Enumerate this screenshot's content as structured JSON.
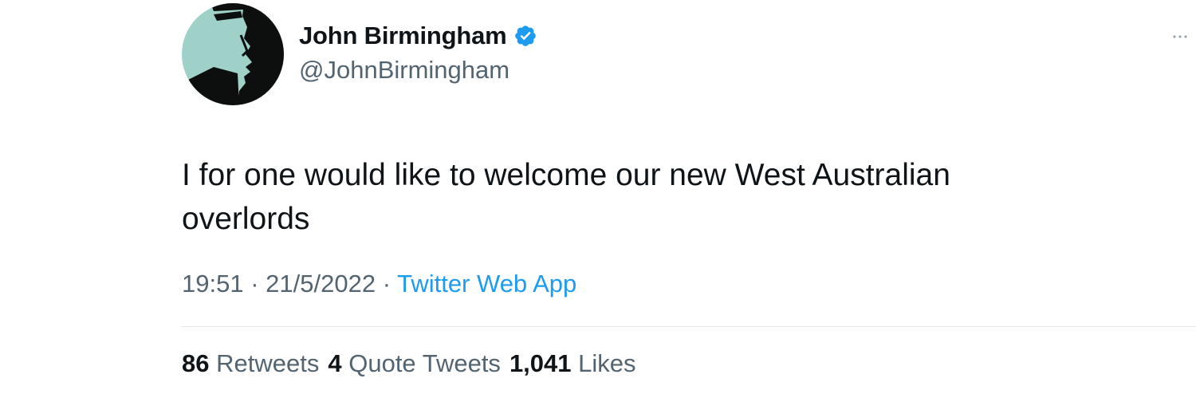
{
  "tweet": {
    "author": {
      "display_name": "John Birmingham",
      "handle": "@JohnBirmingham",
      "verified": true,
      "avatar_icon": "avatar-portrait-silhouette"
    },
    "text_line1": "I for one would like to welcome our new West Australian",
    "text_line2": "overlords",
    "time": "19:51",
    "separator": "·",
    "date": "21/5/2022",
    "source": "Twitter Web App",
    "stats": {
      "retweets_count": "86",
      "retweets_label": "Retweets",
      "quotes_count": "4",
      "quotes_label": "Quote Tweets",
      "likes_count": "1,041",
      "likes_label": "Likes"
    }
  },
  "colors": {
    "text_primary": "#0f1419",
    "text_secondary": "#536471",
    "accent": "#1d9bf0",
    "avatar_bg": "#9fd1c9",
    "divider": "#e3e6e9"
  },
  "icons": {
    "verified": "verified-badge-icon",
    "more": "more-options-icon"
  }
}
